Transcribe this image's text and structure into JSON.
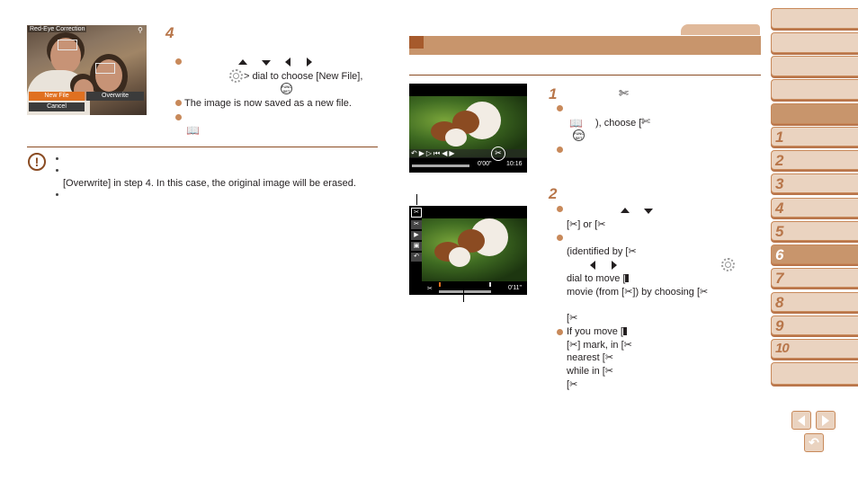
{
  "left_section": {
    "screen_title": "Red-Eye Correction",
    "screen_buttons": [
      "New File",
      "Overwrite",
      "Cancel"
    ],
    "step4": {
      "number": "4",
      "line1_suffix": "> dial to choose [New File],",
      "bullet2": "The image is now saved as a new file."
    },
    "caution": {
      "line_overwrite": "[Overwrite] in step 4. In this case, the original image will be erased."
    }
  },
  "right_section": {
    "video1": {
      "time_elapsed": "0'00\"",
      "time_total": "10:16"
    },
    "step1": {
      "number": "1",
      "choose_text": "), choose ["
    },
    "video2": {
      "time": "0'11\""
    },
    "step2": {
      "number": "2",
      "or_text": "[",
      "or_middle": "] or [",
      "identified": "(identified by [",
      "dial_move": "dial to move [",
      "movie_from_1": "movie (from [",
      "movie_from_2": "]) by choosing [",
      "bracket_open": "[",
      "if_move": "If you move [",
      "mark_in_1": "] mark, in [",
      "nearest": "nearest [",
      "while_in": "while in ["
    }
  },
  "sidebar": {
    "tabs": [
      "",
      "",
      "",
      "",
      ""
    ],
    "chapters": [
      "1",
      "2",
      "3",
      "4",
      "5",
      "6",
      "7",
      "8",
      "9",
      "10",
      ""
    ],
    "active_chapter": "6"
  },
  "nav": {
    "prev": "previous-page",
    "next": "next-page",
    "back": "return"
  },
  "colors": {
    "accent": "#c8956c",
    "accent_dark": "#a65a2c",
    "tab_light": "#ead3c0",
    "bullet": "#c8895a"
  }
}
